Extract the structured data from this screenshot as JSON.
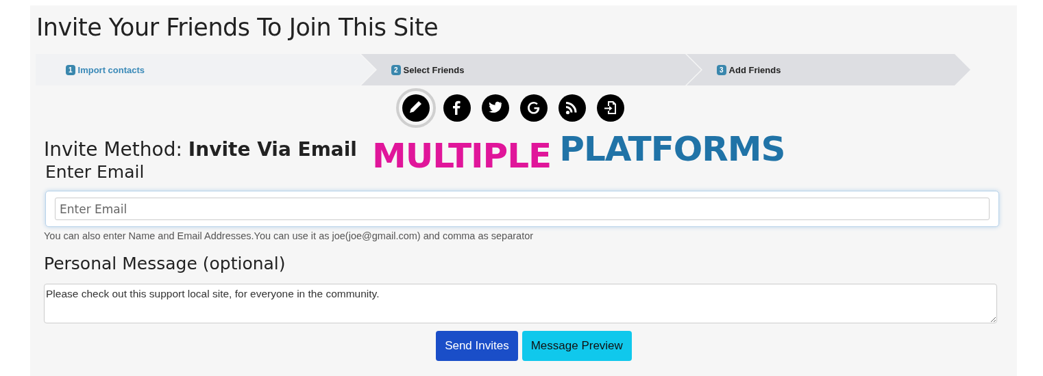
{
  "page_title": "Invite Your Friends To Join This Site",
  "steps": [
    {
      "number": "1",
      "label": "Import contacts",
      "selected": true
    },
    {
      "number": "2",
      "label": "Select Friends",
      "selected": false
    },
    {
      "number": "3",
      "label": "Add Friends",
      "selected": false
    }
  ],
  "methods": [
    {
      "kind": "pencil",
      "selected": true
    },
    {
      "kind": "facebook",
      "selected": false
    },
    {
      "kind": "twitter",
      "selected": false
    },
    {
      "kind": "google",
      "selected": false
    },
    {
      "kind": "rss",
      "selected": false
    },
    {
      "kind": "import",
      "selected": false
    }
  ],
  "invite_method": {
    "label": "Invite Method:",
    "value": "Invite Via Email"
  },
  "banner": {
    "word_1": "MULTIPLE",
    "word_2": "PLATFORMS"
  },
  "email": {
    "label": "Enter Email",
    "placeholder": "Enter Email",
    "help": "You can also enter Name and Email Addresses.You can use it as joe(joe@gmail.com) and comma as separator"
  },
  "message": {
    "label": "Personal Message (optional)",
    "value": "Please check out this support local site, for everyone in the community."
  },
  "buttons": [
    {
      "kind": "primary",
      "label": "Send Invites"
    },
    {
      "kind": "info",
      "label": "Message Preview"
    }
  ]
}
